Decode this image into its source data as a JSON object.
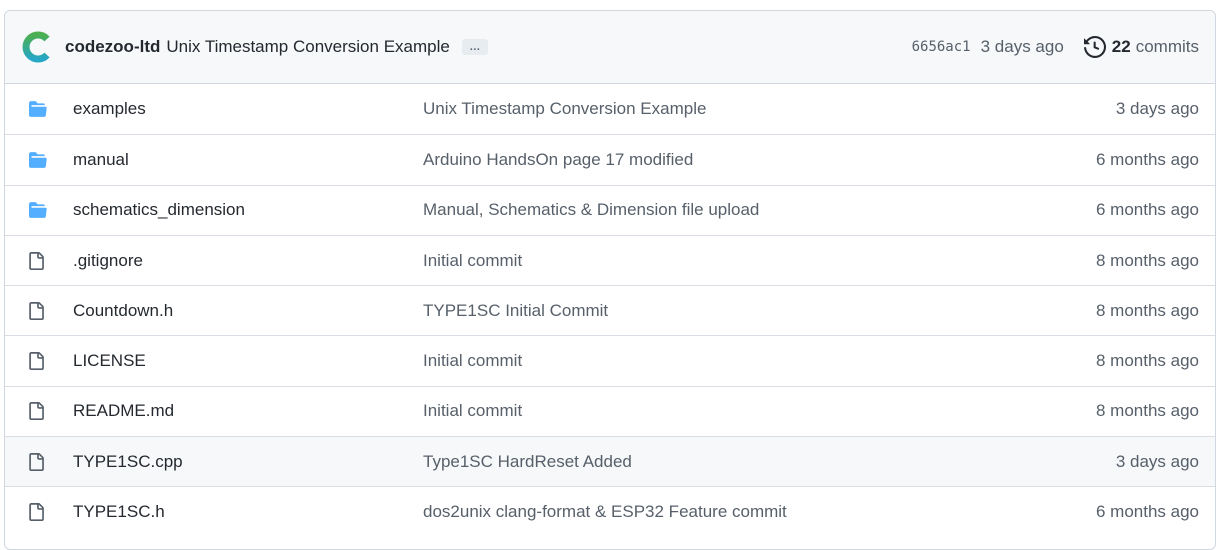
{
  "latest_commit": {
    "author": "codezoo-ltd",
    "message": "Unix Timestamp Conversion Example",
    "ellipsis": "…",
    "sha": "6656ac1",
    "age": "3 days ago",
    "commit_count": "22",
    "commits_label": "commits"
  },
  "colors": {
    "folder": "#54aeff",
    "file_icon": "#57606a",
    "avatar_top": "#4caf50",
    "avatar_bottom": "#26a7c6"
  },
  "files": [
    {
      "type": "folder",
      "icon": "folder-icon",
      "name": "examples",
      "message": "Unix Timestamp Conversion Example",
      "time": "3 days ago"
    },
    {
      "type": "folder",
      "icon": "folder-icon",
      "name": "manual",
      "message": "Arduino HandsOn page 17 modified",
      "time": "6 months ago"
    },
    {
      "type": "folder",
      "icon": "folder-icon",
      "name": "schematics_dimension",
      "message": "Manual, Schematics & Dimension file upload",
      "time": "6 months ago"
    },
    {
      "type": "file",
      "icon": "file-icon",
      "name": ".gitignore",
      "message": "Initial commit",
      "time": "8 months ago"
    },
    {
      "type": "file",
      "icon": "file-icon",
      "name": "Countdown.h",
      "message": "TYPE1SC Initial Commit",
      "time": "8 months ago"
    },
    {
      "type": "file",
      "icon": "file-icon",
      "name": "LICENSE",
      "message": "Initial commit",
      "time": "8 months ago"
    },
    {
      "type": "file",
      "icon": "file-icon",
      "name": "README.md",
      "message": "Initial commit",
      "time": "8 months ago"
    },
    {
      "type": "file",
      "icon": "file-icon",
      "name": "TYPE1SC.cpp",
      "message": "Type1SC HardReset Added",
      "time": "3 days ago"
    },
    {
      "type": "file",
      "icon": "file-icon",
      "name": "TYPE1SC.h",
      "message": "dos2unix clang-format & ESP32 Feature commit",
      "time": "6 months ago"
    }
  ]
}
